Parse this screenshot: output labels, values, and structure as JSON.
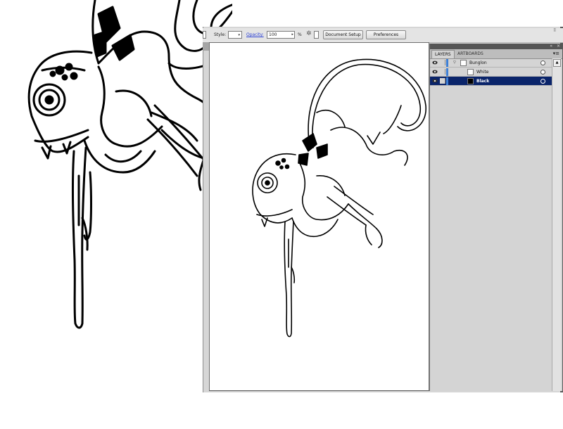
{
  "control_bar": {
    "style_label": "Style:",
    "opacity_label": "Opacity:",
    "opacity_value": "100",
    "percent_label": "%",
    "document_setup_label": "Document Setup",
    "preferences_label": "Preferences"
  },
  "layers_panel": {
    "tabs": [
      {
        "label": "LAYERS",
        "active": true
      },
      {
        "label": "ARTBOARDS",
        "active": false
      }
    ],
    "rows": [
      {
        "name": "Bunglon",
        "type": "layer",
        "expanded": true,
        "selected": false,
        "color": "#3c7fd6"
      },
      {
        "name": "White",
        "type": "sublayer",
        "selected": false,
        "color": "#3c7fd6"
      },
      {
        "name": "Black",
        "type": "sublayer",
        "selected": true,
        "color": "#3c7fd6"
      }
    ]
  },
  "icons": {
    "eye": "eye-icon",
    "target": "target-circle-icon",
    "panel_menu": "panel-menu-icon",
    "wand": "recolor-artwork-icon"
  },
  "colors": {
    "selection": "#0a246a",
    "panel_bg": "#d4d4d4",
    "toolbar_bg": "#e4e4e4"
  }
}
